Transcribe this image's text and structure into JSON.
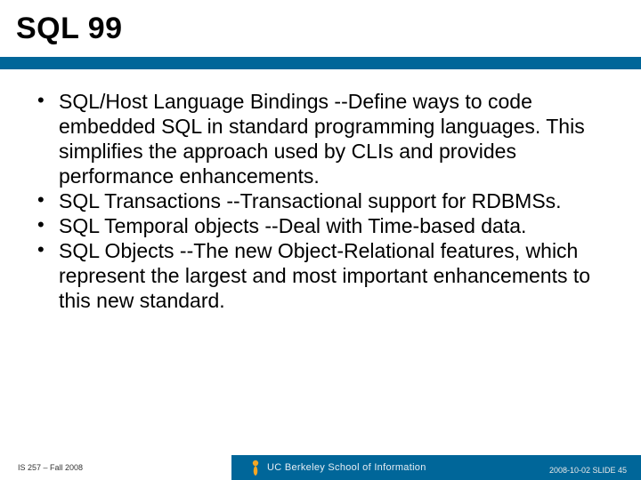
{
  "title": "SQL 99",
  "bullets": [
    "SQL/Host Language Bindings --Define ways to code embedded SQL in standard programming languages. This simplifies the approach used by CLIs and provides performance enhancements.",
    "SQL Transactions --Transactional support for RDBMSs.",
    "SQL Temporal objects --Deal with Time-based data.",
    "SQL Objects --The new Object-Relational features, which represent the largest and most important enhancements to this new standard."
  ],
  "footer": {
    "left": "IS 257 – Fall 2008",
    "school": "UC Berkeley School of Information",
    "right": "2008-10-02  SLIDE 45"
  }
}
